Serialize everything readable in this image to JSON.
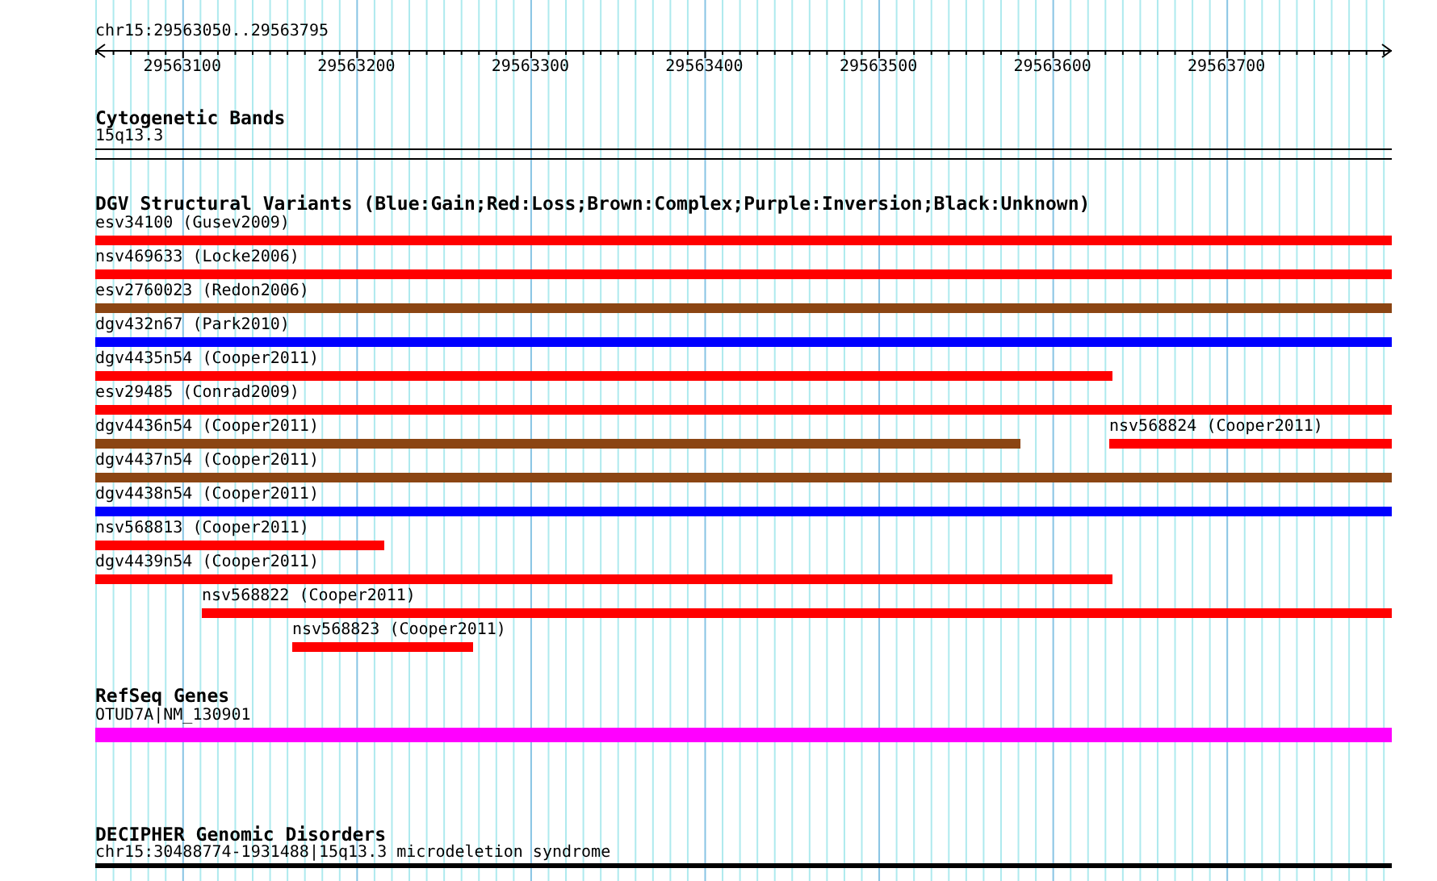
{
  "ruler": {
    "range": "chr15:29563050..29563795",
    "ticks": [
      "29563100",
      "29563200",
      "29563300",
      "29563400",
      "29563500",
      "29563600",
      "29563700"
    ]
  },
  "tracks": [
    {
      "kind": "bands",
      "title": "Cytogenetic Bands",
      "items": [
        {
          "label": "15q13.3"
        }
      ]
    },
    {
      "kind": "variants",
      "title": "DGV Structural Variants (Blue:Gain;Red:Loss;Brown:Complex;Purple:Inversion;Black:Unknown)",
      "rows": [
        [
          {
            "label": "esv34100 (Gusev2009)",
            "color": "#ff0000"
          }
        ],
        [
          {
            "label": "nsv469633 (Locke2006)",
            "color": "#ff0000"
          }
        ],
        [
          {
            "label": "esv2760023 (Redon2006)",
            "color": "#8b4513"
          }
        ],
        [
          {
            "label": "dgv432n67 (Park2010)",
            "color": "#0000ff"
          }
        ],
        [
          {
            "label": "dgv4435n54 (Cooper2011)",
            "color": "#ff0000"
          }
        ],
        [
          {
            "label": "esv29485 (Conrad2009)",
            "color": "#ff0000"
          }
        ],
        [
          {
            "label": "dgv4436n54 (Cooper2011)",
            "color": "#8b4513"
          },
          {
            "label": "nsv568824 (Cooper2011)",
            "color": "#ff0000"
          }
        ],
        [
          {
            "label": "dgv4437n54 (Cooper2011)",
            "color": "#8b4513"
          }
        ],
        [
          {
            "label": "dgv4438n54 (Cooper2011)",
            "color": "#0000ff"
          }
        ],
        [
          {
            "label": "nsv568813 (Cooper2011)",
            "color": "#ff0000"
          }
        ],
        [
          {
            "label": "dgv4439n54 (Cooper2011)",
            "color": "#ff0000"
          }
        ],
        [
          {
            "label": "nsv568822 (Cooper2011)",
            "color": "#ff0000"
          }
        ],
        [
          {
            "label": "nsv568823 (Cooper2011)",
            "color": "#ff0000"
          }
        ]
      ]
    },
    {
      "kind": "genes",
      "title": "RefSeq Genes",
      "items": [
        {
          "label": "OTUD7A|NM_130901",
          "color": "#ff00ff"
        }
      ]
    },
    {
      "kind": "disorders",
      "title": "DECIPHER Genomic Disorders",
      "items": [
        {
          "label": "chr15:30488774-1931488|15q13.3 microdeletion syndrome",
          "color": "#000000"
        }
      ]
    }
  ]
}
